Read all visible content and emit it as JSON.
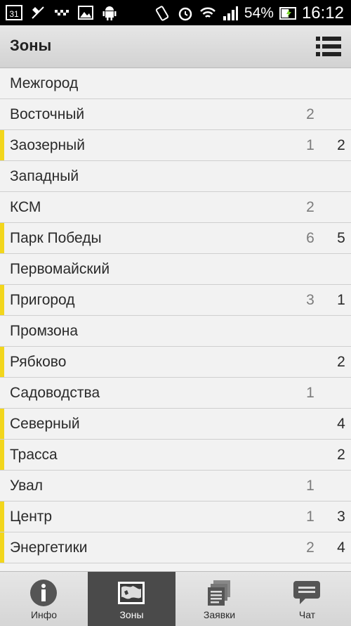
{
  "status_bar": {
    "calendar_day": "31",
    "battery": "54%",
    "time": "16:12",
    "icons": [
      "calendar-icon",
      "location-off-icon",
      "dots-icon",
      "image-icon",
      "android-icon",
      "vibrate-icon",
      "alarm-icon",
      "wifi-icon",
      "signal-icon",
      "battery-icon"
    ]
  },
  "action_bar": {
    "title": "Зоны",
    "menu_icon": "list-menu-icon"
  },
  "zones": [
    {
      "name": "Межгород",
      "c1": "",
      "c2": "",
      "highlight": false
    },
    {
      "name": "Восточный",
      "c1": "2",
      "c2": "",
      "highlight": false
    },
    {
      "name": "Заозерный",
      "c1": "1",
      "c2": "2",
      "highlight": true
    },
    {
      "name": "Западный",
      "c1": "",
      "c2": "",
      "highlight": false
    },
    {
      "name": "КСМ",
      "c1": "2",
      "c2": "",
      "highlight": false
    },
    {
      "name": "Парк Победы",
      "c1": "6",
      "c2": "5",
      "highlight": true
    },
    {
      "name": "Первомайский",
      "c1": "",
      "c2": "",
      "highlight": false
    },
    {
      "name": "Пригород",
      "c1": "3",
      "c2": "1",
      "highlight": true
    },
    {
      "name": "Промзона",
      "c1": "",
      "c2": "",
      "highlight": false
    },
    {
      "name": "Рябково",
      "c1": "",
      "c2": "2",
      "highlight": true
    },
    {
      "name": "Садоводства",
      "c1": "1",
      "c2": "",
      "highlight": false
    },
    {
      "name": "Северный",
      "c1": "",
      "c2": "4",
      "highlight": true
    },
    {
      "name": "Трасса",
      "c1": "",
      "c2": "2",
      "highlight": true
    },
    {
      "name": "Увал",
      "c1": "1",
      "c2": "",
      "highlight": false
    },
    {
      "name": "Центр",
      "c1": "1",
      "c2": "3",
      "highlight": true
    },
    {
      "name": "Энергетики",
      "c1": "2",
      "c2": "4",
      "highlight": true
    }
  ],
  "bottom_nav": [
    {
      "label": "Инфо",
      "icon": "info-icon",
      "active": false
    },
    {
      "label": "Зоны",
      "icon": "map-icon",
      "active": true
    },
    {
      "label": "Заявки",
      "icon": "orders-icon",
      "active": false
    },
    {
      "label": "Чат",
      "icon": "chat-icon",
      "active": false
    }
  ],
  "colors": {
    "highlight": "#f2d61c",
    "active_tab": "#4a4a4a",
    "count_gray": "#7c7c7c"
  }
}
